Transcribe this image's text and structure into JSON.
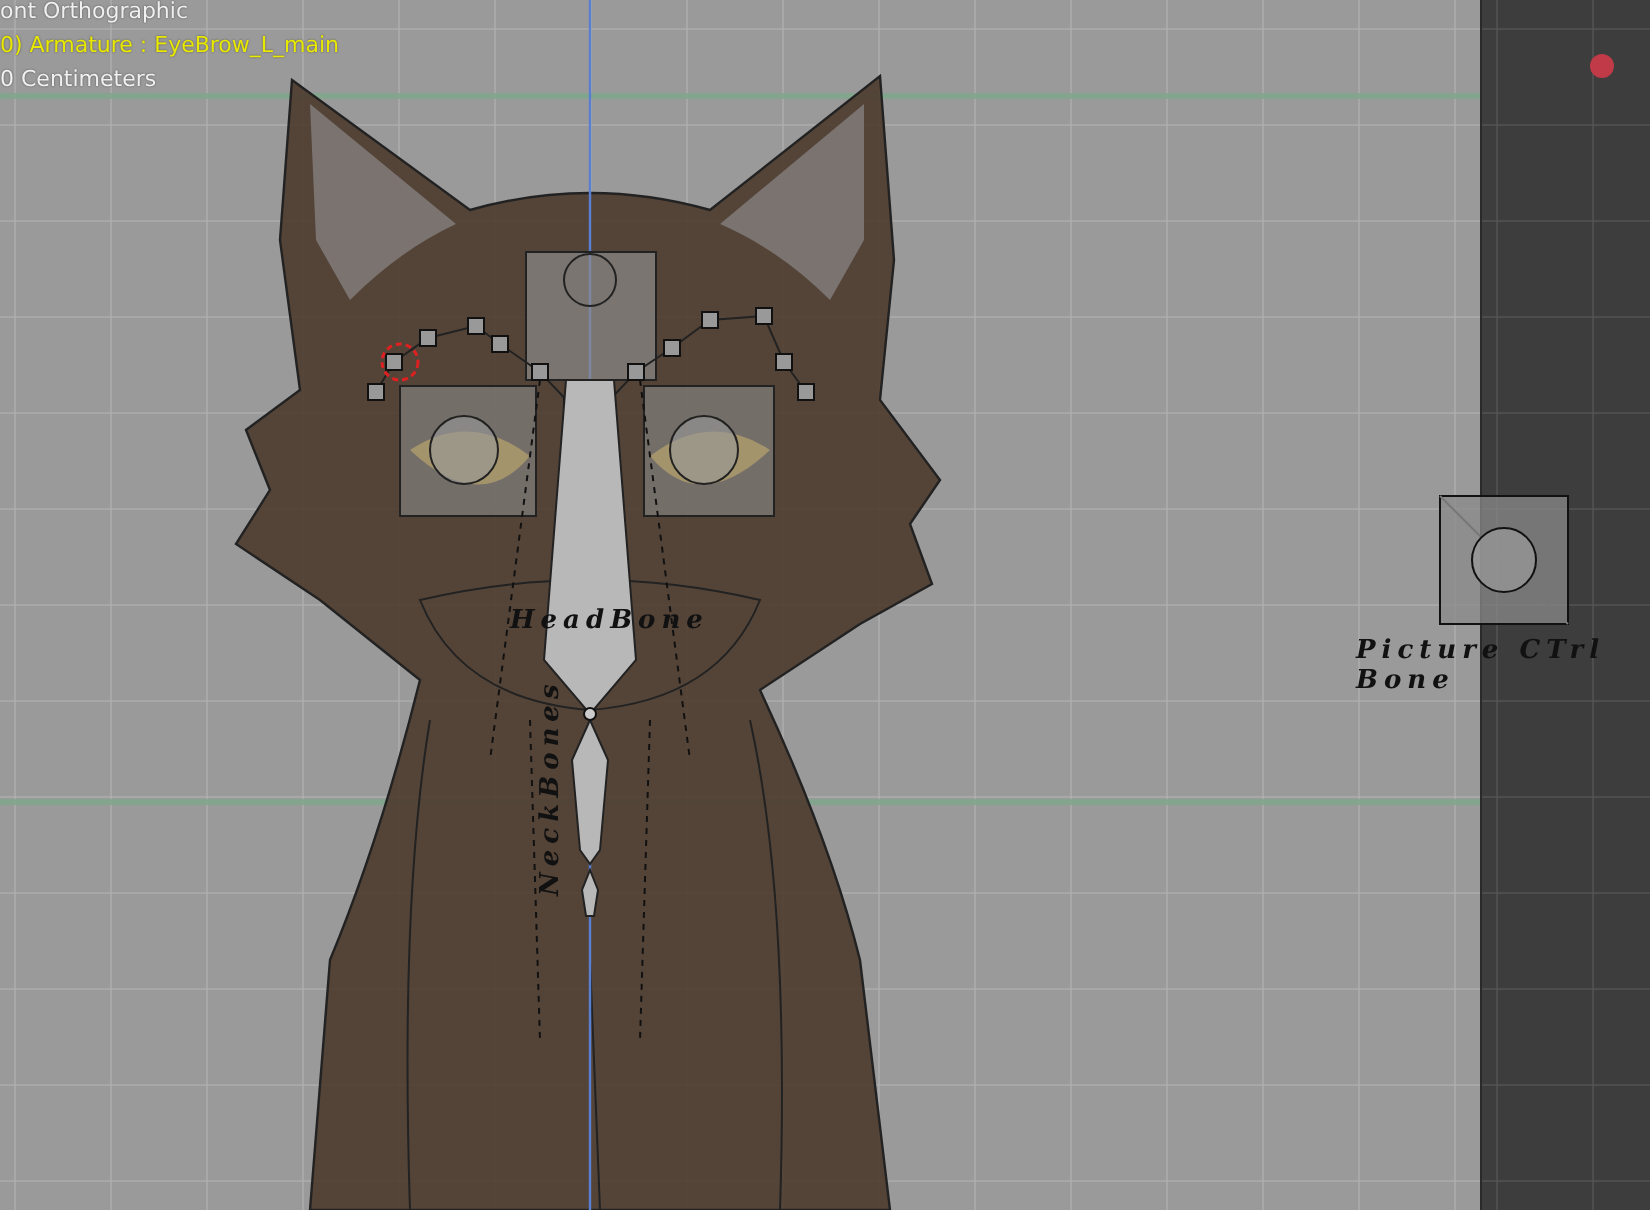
{
  "viewport": {
    "info": [
      {
        "text": "ont Orthographic",
        "kind": "view"
      },
      {
        "text": "0) Armature : EyeBrow_L_main",
        "kind": "object"
      },
      {
        "text": "0 Centimeters",
        "kind": "units"
      }
    ]
  },
  "bone_labels": [
    {
      "text": "HeadBone",
      "kind": "horizontal"
    },
    {
      "text": "NeckBones",
      "kind": "vertical"
    },
    {
      "text": "Picture CTrl Bone",
      "kind": "wrapped"
    }
  ]
}
